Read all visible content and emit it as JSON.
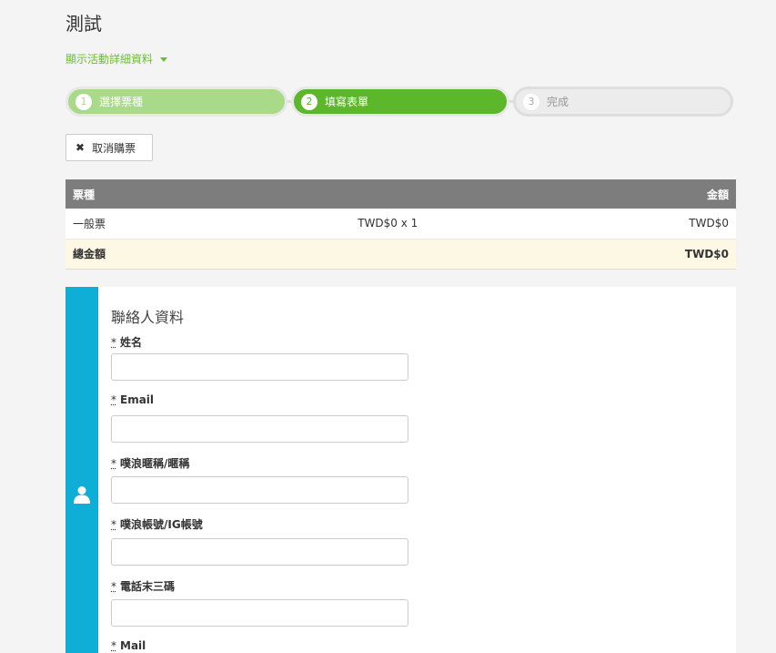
{
  "event": {
    "title": "測試",
    "details_link": "顯示活動詳細資料"
  },
  "steps": [
    {
      "num": "1",
      "label": "選擇票種"
    },
    {
      "num": "2",
      "label": "填寫表單"
    },
    {
      "num": "3",
      "label": "完成"
    }
  ],
  "cancel_button": "取消購票",
  "ticket_table": {
    "headers": {
      "type": "票種",
      "amount": "金額"
    },
    "rows": [
      {
        "type": "一般票",
        "qty": "TWD$0 x 1",
        "amount": "TWD$0"
      }
    ],
    "total": {
      "label": "總金額",
      "amount": "TWD$0"
    }
  },
  "contact": {
    "title": "聯絡人資料",
    "required_mark": "*",
    "fields": [
      {
        "label": "姓名",
        "value": ""
      },
      {
        "label": "Email",
        "value": ""
      },
      {
        "label": "噗浪暱稱/暱稱",
        "value": ""
      },
      {
        "label": "噗浪帳號/IG帳號",
        "value": ""
      },
      {
        "label": "電話末三碼",
        "value": ""
      },
      {
        "label": "Mail",
        "value": ""
      }
    ]
  },
  "colors": {
    "accent_green": "#5cb82a",
    "light_green": "#a8da8a",
    "sidebar_blue": "#0eaed6"
  },
  "icons": {
    "cancel": "close-icon",
    "contact": "user-icon",
    "details": "caret-down-icon"
  }
}
